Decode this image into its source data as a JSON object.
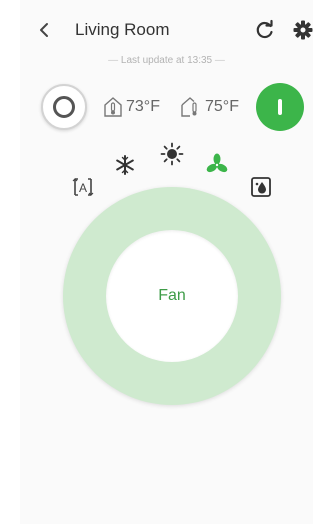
{
  "header": {
    "title": "Living Room",
    "back_icon": "chevron-left-icon",
    "refresh_icon": "refresh-icon",
    "settings_icon": "gear-icon"
  },
  "status": {
    "last_update": "Last update at 13:35"
  },
  "temperatures": {
    "indoor": "73°F",
    "outdoor": "75°F"
  },
  "modes": [
    {
      "name": "auto",
      "icon": "auto-mode-icon"
    },
    {
      "name": "cool",
      "icon": "snowflake-icon"
    },
    {
      "name": "heat",
      "icon": "sun-icon"
    },
    {
      "name": "fan",
      "icon": "fan-icon",
      "active": true
    },
    {
      "name": "dry",
      "icon": "drop-icon"
    }
  ],
  "dial": {
    "label": "Fan"
  },
  "colors": {
    "accent": "#3cb54a",
    "dial": "#cfeacf",
    "text": "#333333"
  }
}
